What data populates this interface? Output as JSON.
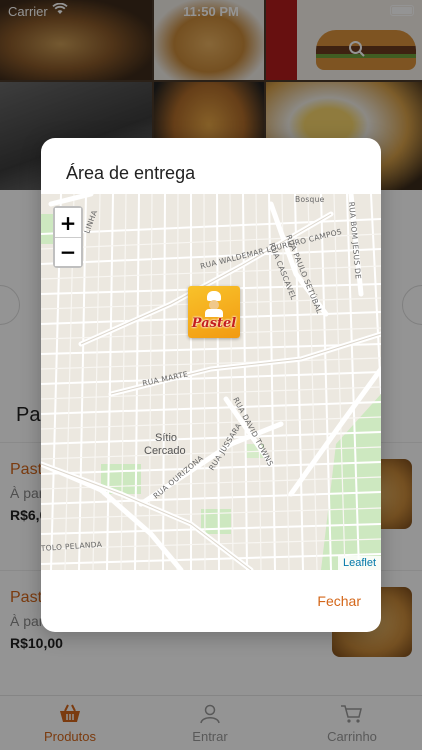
{
  "status_bar": {
    "carrier": "Carrier",
    "time": "11:50 PM"
  },
  "list": {
    "section_title": "Pas",
    "products": [
      {
        "name": "Past",
        "subtitle": "À par",
        "price": "R$6,0"
      },
      {
        "name": "Past",
        "subtitle": "À par",
        "price": "R$10,00"
      }
    ]
  },
  "tabbar": {
    "tabs": [
      {
        "label": "Produtos",
        "icon": "basket-icon",
        "active": true
      },
      {
        "label": "Entrar",
        "icon": "user-icon",
        "active": false
      },
      {
        "label": "Carrinho",
        "icon": "cart-icon",
        "active": false
      }
    ]
  },
  "modal": {
    "title": "Área de entrega",
    "zoom_in": "+",
    "zoom_out": "−",
    "marker_brand": "Pastel",
    "attribution": "Leaflet",
    "close_label": "Fechar",
    "streets": [
      "RUA WALDEMAR LOUREIRO CAMPOS",
      "RUA PAULO SETÚBAL",
      "RUA CASCAVEL",
      "RUA MARTE",
      "RUA DAVID TOWNS",
      "RUA JUSSARA",
      "RUA OURIZONA",
      "TOLO PELANDA",
      "RUA BOM JESUS DE",
      "LINHA",
      "Bosque"
    ],
    "place_name_1": "Sítio",
    "place_name_2": "Cercado"
  },
  "colors": {
    "accent": "#d4671a",
    "marker": "#f8c22a"
  }
}
